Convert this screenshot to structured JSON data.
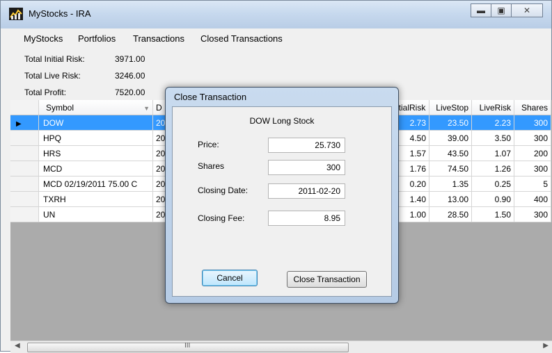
{
  "window": {
    "title": "MyStocks - IRA"
  },
  "menu": [
    "MyStocks",
    "Portfolios",
    "Transactions",
    "Closed Transactions"
  ],
  "summary": {
    "initial_risk_label": "Total Initial  Risk:",
    "initial_risk_value": "3971.00",
    "live_risk_label": "Total Live Risk:",
    "live_risk_value": "3246.00",
    "profit_label": "Total Profit:",
    "profit_value": "7520.00"
  },
  "grid": {
    "columns": [
      "Symbol",
      "D",
      "itialRisk",
      "LiveStop",
      "LiveRisk",
      "Shares"
    ],
    "rows": [
      {
        "symbol": "DOW",
        "date": "20",
        "initial_risk": "2.73",
        "live_stop": "23.50",
        "live_risk": "2.23",
        "shares": "300"
      },
      {
        "symbol": "HPQ",
        "date": "20",
        "initial_risk": "4.50",
        "live_stop": "39.00",
        "live_risk": "3.50",
        "shares": "300"
      },
      {
        "symbol": "HRS",
        "date": "20",
        "initial_risk": "1.57",
        "live_stop": "43.50",
        "live_risk": "1.07",
        "shares": "200"
      },
      {
        "symbol": "MCD",
        "date": "20",
        "initial_risk": "1.76",
        "live_stop": "74.50",
        "live_risk": "1.26",
        "shares": "300"
      },
      {
        "symbol": "MCD 02/19/2011 75.00 C",
        "date": "20",
        "initial_risk": "0.20",
        "live_stop": "1.35",
        "live_risk": "0.25",
        "shares": "5"
      },
      {
        "symbol": "TXRH",
        "date": "20",
        "initial_risk": "1.40",
        "live_stop": "13.00",
        "live_risk": "0.90",
        "shares": "400"
      },
      {
        "symbol": "UN",
        "date": "20",
        "initial_risk": "1.00",
        "live_stop": "28.50",
        "live_risk": "1.50",
        "shares": "300"
      }
    ]
  },
  "scrollbar": {
    "grip": "III"
  },
  "dialog": {
    "title": "Close Transaction",
    "heading": "DOW Long Stock",
    "price_label": "Price:",
    "price_value": "25.730",
    "shares_label": "Shares",
    "shares_value": "300",
    "closing_date_label": "Closing Date:",
    "closing_date_value": "2011-02-20",
    "closing_fee_label": "Closing Fee:",
    "closing_fee_value": "8.95",
    "cancel_label": "Cancel",
    "close_label": "Close Transaction"
  },
  "icons": {
    "app": "stock-chart-icon",
    "minimize": "minimize-icon",
    "maximize": "maximize-icon",
    "close": "close-icon",
    "row_pointer": "row-pointer-icon",
    "sort": "sort-arrow-icon"
  },
  "colors": {
    "selection": "#3399ff",
    "grid_background": "#ababab"
  }
}
